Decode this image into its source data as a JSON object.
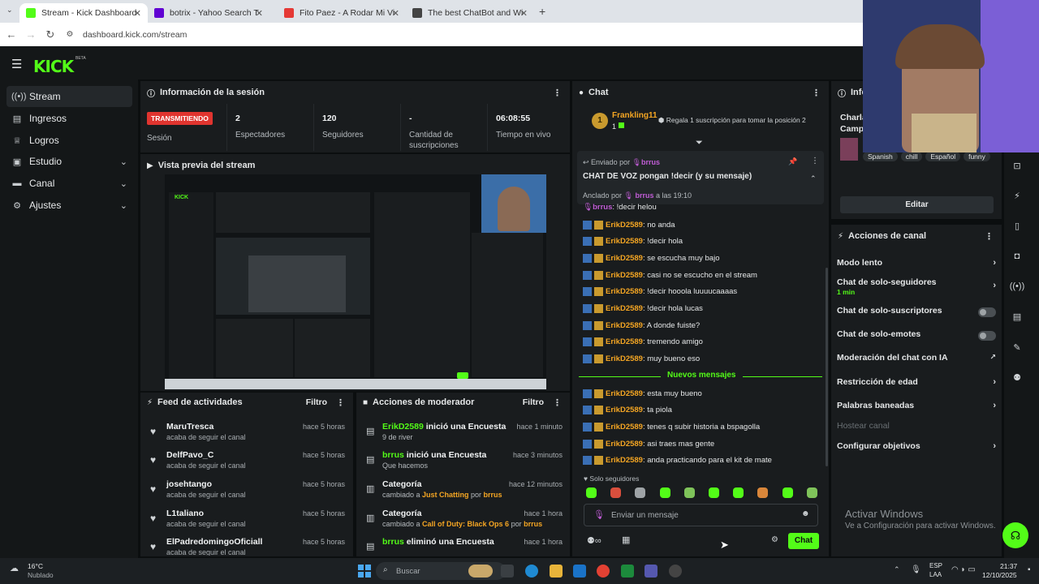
{
  "browser": {
    "tabs": [
      {
        "title": "Stream - Kick Dashboard",
        "color": "#53fc18"
      },
      {
        "title": "botrix - Yahoo Search Tus resul",
        "color": "#6001d2"
      },
      {
        "title": "Fito Paez - A Rodar Mi Vida (Er",
        "color": "#e53935"
      },
      {
        "title": "The best ChatBot and Widgets",
        "color": "#444444"
      }
    ],
    "url": "dashboard.kick.com/stream"
  },
  "brand": {
    "logo": "KICK",
    "beta": "BETA"
  },
  "sidebar": {
    "items": [
      {
        "label": "Stream",
        "icon": "stream-icon"
      },
      {
        "label": "Ingresos",
        "icon": "money-icon"
      },
      {
        "label": "Logros",
        "icon": "trophy-icon"
      },
      {
        "label": "Estudio",
        "icon": "studio-icon"
      },
      {
        "label": "Canal",
        "icon": "channel-icon"
      },
      {
        "label": "Ajustes",
        "icon": "gear-icon"
      }
    ]
  },
  "session": {
    "title": "Información de la sesión",
    "status": "TRANSMITIENDO",
    "status_label": "Sesión",
    "stats": [
      {
        "value": "2",
        "label": "Espectadores"
      },
      {
        "value": "120",
        "label": "Seguidores"
      },
      {
        "value": "-",
        "label": "Cantidad de suscripciones"
      },
      {
        "value": "06:08:55",
        "label": "Tiempo en vivo"
      }
    ]
  },
  "preview": {
    "title": "Vista previa del stream"
  },
  "feed": {
    "title": "Feed de actividades",
    "filter": "Filtro",
    "items": [
      {
        "name": "MaruTresca",
        "action": "acaba de seguir el canal",
        "time": "hace 5 horas"
      },
      {
        "name": "DelfPavo_C",
        "action": "acaba de seguir el canal",
        "time": "hace 5 horas"
      },
      {
        "name": "josehtango",
        "action": "acaba de seguir el canal",
        "time": "hace 5 horas"
      },
      {
        "name": "L1taliano",
        "action": "acaba de seguir el canal",
        "time": "hace 5 horas"
      },
      {
        "name": "ElPadredomingoOficiall",
        "action": "acaba de seguir el canal",
        "time": "hace 5 horas"
      }
    ]
  },
  "mod": {
    "title": "Acciones de moderador",
    "filter": "Filtro",
    "items": [
      {
        "user": "ErikD2589",
        "text": " inició una Encuesta",
        "sub": "9 de river",
        "time": "hace 1 minuto",
        "icon": "poll-icon"
      },
      {
        "user": "brrus",
        "text": " inició una Encuesta",
        "sub": "Que hacemos",
        "time": "hace 3 minutos",
        "icon": "poll-icon"
      },
      {
        "user": "",
        "text": "Categoría",
        "sub_prefix": "cambiado a ",
        "sub_cat": "Just Chatting",
        "sub_mid": " por ",
        "sub_user": "brrus",
        "time": "hace 12 minutos",
        "icon": "category-icon"
      },
      {
        "user": "",
        "text": "Categoría",
        "sub_prefix": "cambiado a ",
        "sub_cat": "Call of Duty: Black Ops 6",
        "sub_mid": " por ",
        "sub_user": "brrus",
        "time": "hace 1 hora",
        "icon": "category-icon"
      },
      {
        "user": "brrus",
        "text": " eliminó una Encuesta",
        "sub": "",
        "time": "hace 1 hora",
        "icon": "poll-icon"
      }
    ]
  },
  "chat": {
    "title": "Chat",
    "top_gifter": {
      "rank": "1",
      "name": "Frankling11",
      "count": "1",
      "cta": "Regala 1 suscripción para tomar la posición 2"
    },
    "pinned": {
      "sent_by_label": "Enviado por",
      "sent_by": "brrus",
      "message": "CHAT DE VOZ pongan !decir (y su mensaje)",
      "pinned_by_label": "Anclado por",
      "pinned_by": "brrus",
      "pinned_at": "a las 19:10"
    },
    "partial": {
      "user": "brrus",
      "text": ": !decir helou"
    },
    "messages": [
      {
        "user": "ErikD2589",
        "text": ": no anda"
      },
      {
        "user": "ErikD2589",
        "text": ": !decir hola"
      },
      {
        "user": "ErikD2589",
        "text": ": se escucha muy bajo"
      },
      {
        "user": "ErikD2589",
        "text": ": casi no se escucho en el stream"
      },
      {
        "user": "ErikD2589",
        "text": ": !decir hooola luuuucaaaas"
      },
      {
        "user": "ErikD2589",
        "text": ": !decir hola lucas"
      },
      {
        "user": "ErikD2589",
        "text": ": A donde fuiste?"
      },
      {
        "user": "ErikD2589",
        "text": ": tremendo amigo"
      },
      {
        "user": "ErikD2589",
        "text": ": muy bueno eso"
      }
    ],
    "new_messages": "Nuevos mensajes",
    "new": [
      {
        "user": "ErikD2589",
        "text": ": esta muy bueno"
      },
      {
        "user": "ErikD2589",
        "text": ": ta piola"
      },
      {
        "user": "ErikD2589",
        "text": ": tenes q subir historia a bspagolla"
      },
      {
        "user": "ErikD2589",
        "text": ": asi traes mas gente"
      },
      {
        "user": "ErikD2589",
        "text": ": anda practicando para el kit de mate"
      }
    ],
    "followers_only": "Solo seguidores",
    "input_placeholder": "Enviar un mensaje",
    "send": "Chat"
  },
  "info": {
    "title": "Info",
    "stream_title": "Charla",
    "stream_title2": "Campa",
    "tags": [
      "Spanish",
      "chill",
      "Español",
      "funny"
    ],
    "edit": "Editar"
  },
  "actions": {
    "title": "Acciones de canal",
    "items": [
      {
        "label": "Modo lento",
        "type": "chev",
        "sub": ""
      },
      {
        "label": "Chat de solo-seguidores",
        "type": "chev",
        "sub": "1 min"
      },
      {
        "label": "Chat de solo-suscriptores",
        "type": "toggle",
        "sub": ""
      },
      {
        "label": "Chat de solo-emotes",
        "type": "toggle",
        "sub": ""
      },
      {
        "label": "Moderación del chat con IA",
        "type": "link",
        "sub": ""
      },
      {
        "label": "Restricción de edad",
        "type": "chev",
        "sub": ""
      },
      {
        "label": "Palabras baneadas",
        "type": "chev",
        "sub": ""
      },
      {
        "label": "Hostear canal",
        "type": "disabled",
        "sub": ""
      },
      {
        "label": "Configurar objetivos",
        "type": "chev",
        "sub": ""
      }
    ]
  },
  "windows": {
    "activate_title": "Activar Windows",
    "activate_sub": "Ve a Configuración para activar Windows.",
    "weather_temp": "16°C",
    "weather_desc": "Nublado",
    "search": "Buscar",
    "lang": "ESP",
    "lang2": "LAA",
    "time": "21:37",
    "date": "12/10/2025"
  }
}
